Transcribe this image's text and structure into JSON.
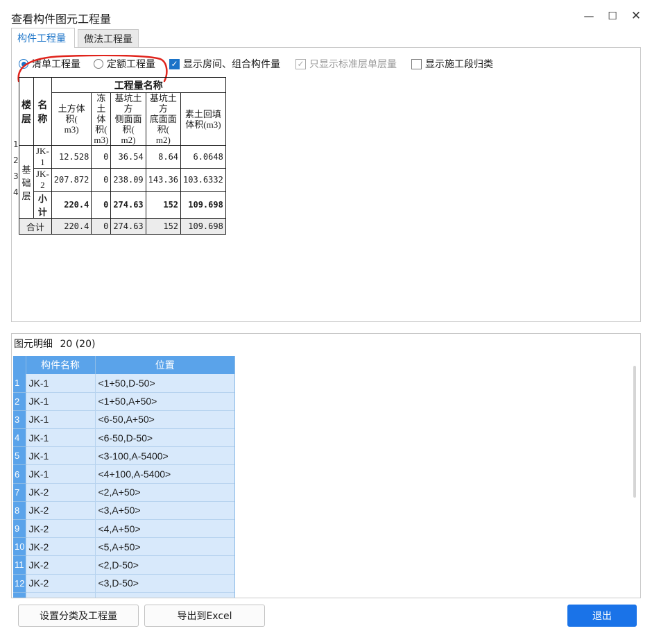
{
  "window": {
    "title": "查看构件图元工程量"
  },
  "tabs": [
    {
      "label": "构件工程量"
    },
    {
      "label": "做法工程量"
    }
  ],
  "options": {
    "radio_qingdan": "清单工程量",
    "radio_dinge": "定额工程量",
    "chk_rooms": "显示房间、组合构件量",
    "chk_standard": "只显示标准层单层量",
    "chk_stage": "显示施工段归类"
  },
  "qty_table": {
    "head_group": "工程量名称",
    "col_floor": "楼层",
    "col_name": "名称",
    "col_tufang": "土方体积(m3)",
    "col_tufang_a": "土方体积(",
    "col_tufang_b": "m3)",
    "col_dongtu_a": "冻土体积(",
    "col_dongtu_b": "m3)",
    "col_cemian_a": "基坑土方",
    "col_cemian_b": "侧面面积(",
    "col_cemian_c": "m2)",
    "col_dimian_a": "基坑土方",
    "col_dimian_b": "底面面积(",
    "col_dimian_c": "m2)",
    "col_huitian_a": "素土回填",
    "col_huitian_b": "体积(m3)",
    "floor_label": "基础层",
    "row_numbers": [
      "1",
      "2",
      "3",
      "4"
    ],
    "rows": [
      {
        "name": "JK-1",
        "tufang": "12.528",
        "dongtu": "0",
        "cemian": "36.54",
        "dimian": "8.64",
        "huitian": "6.0648"
      },
      {
        "name": "JK-2",
        "tufang": "207.872",
        "dongtu": "0",
        "cemian": "238.09",
        "dimian": "143.36",
        "huitian": "103.6332"
      },
      {
        "name": "小计",
        "tufang": "220.4",
        "dongtu": "0",
        "cemian": "274.63",
        "dimian": "152",
        "huitian": "109.698"
      }
    ],
    "total": {
      "label": "合计",
      "tufang": "220.4",
      "dongtu": "0",
      "cemian": "274.63",
      "dimian": "152",
      "huitian": "109.698"
    }
  },
  "detail": {
    "label": "图元明细",
    "count": "20 (20)",
    "col_name": "构件名称",
    "col_pos": "位置",
    "rows": [
      {
        "idx": "1",
        "name": "JK-1",
        "pos": "<1+50,D-50>"
      },
      {
        "idx": "2",
        "name": "JK-1",
        "pos": "<1+50,A+50>"
      },
      {
        "idx": "3",
        "name": "JK-1",
        "pos": "<6-50,A+50>"
      },
      {
        "idx": "4",
        "name": "JK-1",
        "pos": "<6-50,D-50>"
      },
      {
        "idx": "5",
        "name": "JK-1",
        "pos": "<3-100,A-5400>"
      },
      {
        "idx": "6",
        "name": "JK-1",
        "pos": "<4+100,A-5400>"
      },
      {
        "idx": "7",
        "name": "JK-2",
        "pos": "<2,A+50>"
      },
      {
        "idx": "8",
        "name": "JK-2",
        "pos": "<3,A+50>"
      },
      {
        "idx": "9",
        "name": "JK-2",
        "pos": "<4,A+50>"
      },
      {
        "idx": "10",
        "name": "JK-2",
        "pos": "<5,A+50>"
      },
      {
        "idx": "11",
        "name": "JK-2",
        "pos": "<2,D-50>"
      },
      {
        "idx": "12",
        "name": "JK-2",
        "pos": "<3,D-50>"
      },
      {
        "idx": "",
        "name": "",
        "pos": ""
      }
    ]
  },
  "buttons": {
    "setup": "设置分类及工程量",
    "export": "导出到Excel",
    "exit": "退出"
  },
  "colors": {
    "accent": "#1a73e8",
    "annotation": "#e0231b",
    "detail_header": "#5aa3ea",
    "detail_cell": "#d8e9fb"
  }
}
